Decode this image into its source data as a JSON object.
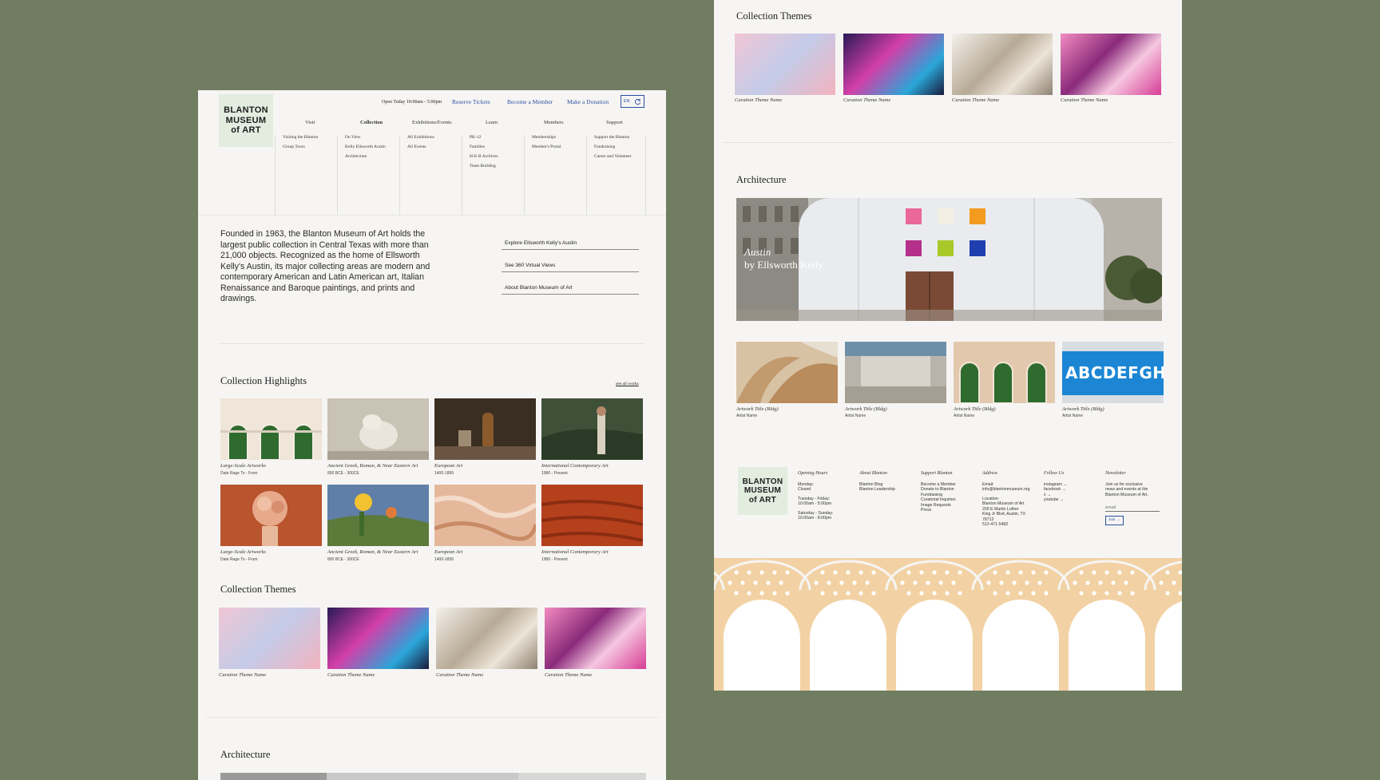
{
  "logo": {
    "line1": "BLANTON",
    "line2": "MUSEUM",
    "line3": "of ART"
  },
  "header": {
    "hours": "Open Today 10:00am - 5:00pm",
    "reserve": "Reserve Tickets",
    "member": "Become a Member",
    "donate": "Make a Donation",
    "lang": "EN"
  },
  "nav": [
    {
      "label": "Visit",
      "items": [
        "Visiting the Blanton",
        "Group Tours"
      ]
    },
    {
      "label": "Collection",
      "items": [
        "On View",
        "Kelly Ellsworth Austin",
        "Architecture"
      ]
    },
    {
      "label": "Exhibitions/Events",
      "items": [
        "All Exhibitions",
        "All Events"
      ]
    },
    {
      "label": "Learn",
      "items": [
        "PK-12",
        "Families",
        "H-E-B Archives",
        "Team Building"
      ]
    },
    {
      "label": "Members",
      "items": [
        "Memberships",
        "Member's Portal"
      ]
    },
    {
      "label": "Support",
      "items": [
        "Support the Blanton",
        "Fundraising",
        "Career and Volunteer"
      ]
    }
  ],
  "intro": "Founded in 1963, the Blanton Museum of Art holds the largest public collection in Central Texas with more than 21,000 objects. Recognized as the home of Ellsworth Kelly's Austin, its major collecting areas are modern and contemporary American and Latin American art, Italian Renaissance and Baroque paintings, and prints and drawings.",
  "quicklinks": [
    "Explore Ellsworth Kelly's Austin",
    "See 360 Virtual Views",
    "About Blanton Museum of Art"
  ],
  "highlights": {
    "title": "Collection Highlights",
    "see_all": "see all works",
    "items": [
      {
        "title": "Large-Scale Artworks",
        "sub": "Date Rage To - From"
      },
      {
        "title": "Ancient Greek, Roman, & Near Eastern Art",
        "sub": "800 BCE - 300CE"
      },
      {
        "title": "European Art",
        "sub": "1400-1899"
      },
      {
        "title": "International Contemporary Art",
        "sub": "1980 - Present"
      },
      {
        "title": "Large-Scale Artworks",
        "sub": "Date Rage To - From"
      },
      {
        "title": "Ancient Greek, Roman, & Near Eastern Art",
        "sub": "800 BCE - 300CE"
      },
      {
        "title": "European Art",
        "sub": "1400-1899"
      },
      {
        "title": "International Contemporary Art",
        "sub": "1980 - Present"
      }
    ]
  },
  "themes": {
    "title": "Collection Themes",
    "items": [
      "Curation Theme Name",
      "Curation Theme Name",
      "Curation Theme Name",
      "Curation Theme Name"
    ]
  },
  "architecture": {
    "title": "Architecture",
    "hero_title": "Austin",
    "hero_sub": "by Ellsworth Kelly",
    "items": [
      {
        "title": "Artwork Title (Bldg)",
        "artist": "Artist Name"
      },
      {
        "title": "Artwork Title (Bldg)",
        "artist": "Artist Name"
      },
      {
        "title": "Artwork Title (Bldg)",
        "artist": "Artist Name"
      },
      {
        "title": "Artwork Title (Bldg)",
        "artist": "Artist Name"
      }
    ],
    "sign_text": "ABCDEFGHI"
  },
  "footer": {
    "hours": {
      "head": "Opening Hours",
      "lines": [
        "Monday:",
        "Closed",
        "",
        "Tuesday - Friday:",
        "10:00am - 5:00pm",
        "",
        "Saturday - Sunday:",
        "10:00am - 8:00pm"
      ]
    },
    "about": {
      "head": "About Blanton",
      "lines": [
        "Blanton Blog",
        "Blanton Leadership"
      ]
    },
    "support": {
      "head": "Support Blanton",
      "lines": [
        "Become a Member",
        "Donate to Blanton",
        "Fundraising",
        "Curatorial Inquiries",
        "Image Requests",
        "Press"
      ]
    },
    "address": {
      "head": "Address",
      "lines": [
        "Email:",
        "info@blantonmuseum.org",
        "",
        "Location:",
        "Blanton Museum of Art",
        "200 E Martin Luther",
        "King Jr Blvd, Austin, TX",
        "78712",
        "512-471-5482"
      ]
    },
    "follow": {
      "head": "Follow Us",
      "lines": [
        "instagram →",
        "facebook →",
        "x →",
        "youtube →"
      ]
    },
    "newsletter": {
      "head": "Newsletter",
      "text": "Join us for exclusive news and events at the Blanton Museum of Art.",
      "placeholder": "email",
      "button": "Join →"
    }
  },
  "colors": {
    "background": "#707d61",
    "panel": "#f6f5f3",
    "logo_bg": "#e2ecdf",
    "link": "#2c4fa0",
    "arch_pattern": "#f2d2a4"
  }
}
